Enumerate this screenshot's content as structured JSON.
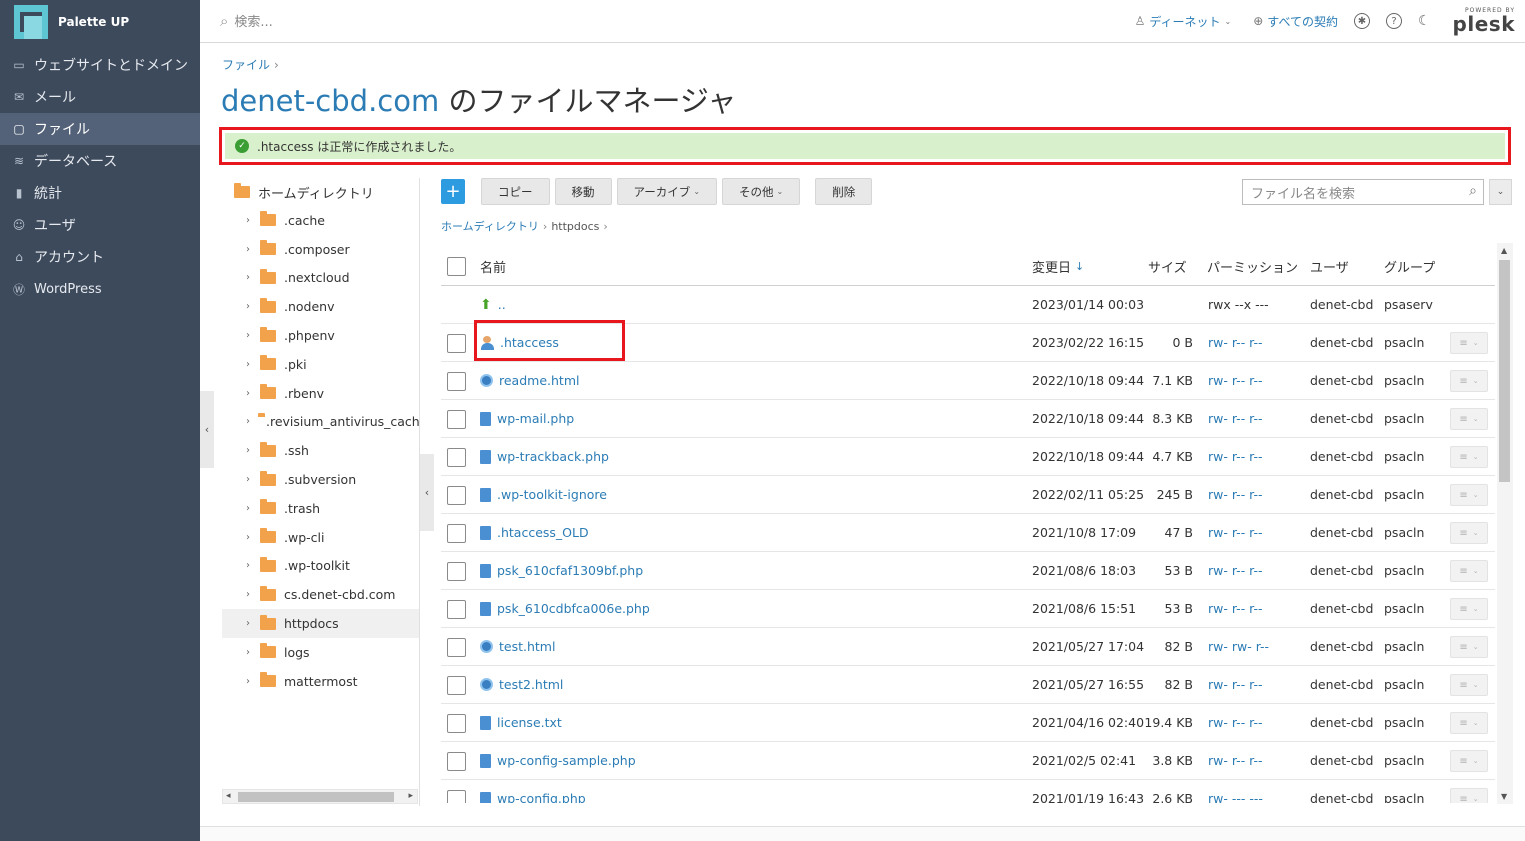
{
  "sidebar": {
    "brand": "Palette UP",
    "items": [
      {
        "label": "ウェブサイトとドメイン",
        "icon": "monitor-icon"
      },
      {
        "label": "メール",
        "icon": "mail-icon"
      },
      {
        "label": "ファイル",
        "icon": "folder-icon"
      },
      {
        "label": "データベース",
        "icon": "database-icon"
      },
      {
        "label": "統計",
        "icon": "bar-chart-icon"
      },
      {
        "label": "ユーザ",
        "icon": "user-icon"
      },
      {
        "label": "アカウント",
        "icon": "account-icon"
      },
      {
        "label": "WordPress",
        "icon": "wordpress-icon"
      }
    ]
  },
  "topbar": {
    "search_placeholder": "検索...",
    "user_menu": "ディーネット",
    "subscriptions": "すべての契約",
    "powered_by": "POWERED BY",
    "plesk": "plesk"
  },
  "breadcrumb": {
    "files": "ファイル"
  },
  "title": {
    "domain": "denet-cbd.com",
    "suffix": " のファイルマネージャ"
  },
  "message": ".htaccess は正常に作成されました。",
  "toolbar": {
    "add": "+",
    "copy": "コピー",
    "move": "移動",
    "archive": "アーカイブ",
    "other": "その他",
    "delete": "削除",
    "search_placeholder": "ファイル名を検索"
  },
  "path": {
    "home": "ホームディレクトリ",
    "current": "httpdocs"
  },
  "tree": {
    "root": "ホームディレクトリ",
    "items": [
      ".cache",
      ".composer",
      ".nextcloud",
      ".nodenv",
      ".phpenv",
      ".pki",
      ".rbenv",
      ".revisium_antivirus_cach",
      ".ssh",
      ".subversion",
      ".trash",
      ".wp-cli",
      ".wp-toolkit",
      "cs.denet-cbd.com",
      "httpdocs",
      "logs",
      "mattermost"
    ],
    "selected": "httpdocs"
  },
  "table": {
    "headers": {
      "name": "名前",
      "date": "変更日",
      "sort": "↓",
      "size": "サイズ",
      "perm": "パーミッション",
      "user": "ユーザ",
      "group": "グループ"
    },
    "parent": {
      "name": "..",
      "date": "2023/01/14 00:03",
      "perm": "rwx --x ---",
      "user": "denet-cbd",
      "group": "psaserv"
    },
    "rows": [
      {
        "name": ".htaccess",
        "icon": "user-file",
        "date": "2023/02/22 16:15",
        "size": "0 B",
        "perm": "rw- r-- r--",
        "user": "denet-cbd",
        "group": "psacln"
      },
      {
        "name": "readme.html",
        "icon": "web-file",
        "date": "2022/10/18 09:44",
        "size": "7.1 KB",
        "perm": "rw- r-- r--",
        "user": "denet-cbd",
        "group": "psacln"
      },
      {
        "name": "wp-mail.php",
        "icon": "file",
        "date": "2022/10/18 09:44",
        "size": "8.3 KB",
        "perm": "rw- r-- r--",
        "user": "denet-cbd",
        "group": "psacln"
      },
      {
        "name": "wp-trackback.php",
        "icon": "file",
        "date": "2022/10/18 09:44",
        "size": "4.7 KB",
        "perm": "rw- r-- r--",
        "user": "denet-cbd",
        "group": "psacln"
      },
      {
        "name": ".wp-toolkit-ignore",
        "icon": "file",
        "date": "2022/02/11 05:25",
        "size": "245 B",
        "perm": "rw- r-- r--",
        "user": "denet-cbd",
        "group": "psacln"
      },
      {
        "name": ".htaccess_OLD",
        "icon": "file",
        "date": "2021/10/8 17:09",
        "size": "47 B",
        "perm": "rw- r-- r--",
        "user": "denet-cbd",
        "group": "psacln"
      },
      {
        "name": "psk_610cfaf1309bf.php",
        "icon": "file",
        "date": "2021/08/6 18:03",
        "size": "53 B",
        "perm": "rw- r-- r--",
        "user": "denet-cbd",
        "group": "psacln"
      },
      {
        "name": "psk_610cdbfca006e.php",
        "icon": "file",
        "date": "2021/08/6 15:51",
        "size": "53 B",
        "perm": "rw- r-- r--",
        "user": "denet-cbd",
        "group": "psacln"
      },
      {
        "name": "test.html",
        "icon": "web-file",
        "date": "2021/05/27 17:04",
        "size": "82 B",
        "perm": "rw- rw- r--",
        "user": "denet-cbd",
        "group": "psacln"
      },
      {
        "name": "test2.html",
        "icon": "web-file",
        "date": "2021/05/27 16:55",
        "size": "82 B",
        "perm": "rw- r-- r--",
        "user": "denet-cbd",
        "group": "psacln"
      },
      {
        "name": "license.txt",
        "icon": "file",
        "date": "2021/04/16 02:40",
        "size": "19.4 KB",
        "perm": "rw- r-- r--",
        "user": "denet-cbd",
        "group": "psacln"
      },
      {
        "name": "wp-config-sample.php",
        "icon": "file",
        "date": "2021/02/5 02:41",
        "size": "3.8 KB",
        "perm": "rw- r-- r--",
        "user": "denet-cbd",
        "group": "psacln"
      },
      {
        "name": "wp-config.php",
        "icon": "file",
        "date": "2021/01/19 16:43",
        "size": "2.6 KB",
        "perm": "rw- --- ---",
        "user": "denet-cbd",
        "group": "psacln"
      }
    ]
  },
  "colors": {
    "sidebar": "#3d4a5c",
    "link": "#2b7cb5",
    "success_bg": "#d9f0cc",
    "highlight": "#e8161d",
    "add_button": "#2d9be0"
  }
}
